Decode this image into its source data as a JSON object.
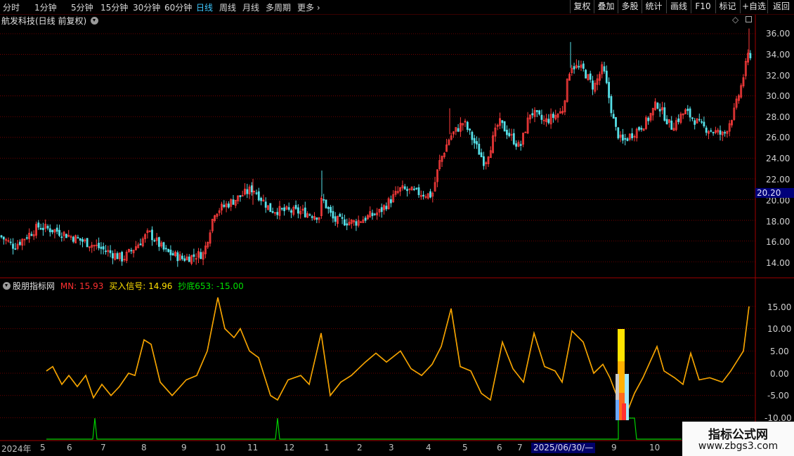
{
  "toolbar": {
    "timeframes": [
      "分时",
      "1分钟",
      "5分钟",
      "15分钟",
      "30分钟",
      "60分钟",
      "日线",
      "周线",
      "月线",
      "多周期",
      "更多"
    ],
    "active_timeframe": "日线",
    "right_buttons": [
      "复权",
      "叠加",
      "多股",
      "统计",
      "画线",
      "F10",
      "标记",
      "+自选",
      "返回"
    ]
  },
  "main_chart": {
    "title": "航发科技(日线 前复权)",
    "y_ticks": [
      "36.00",
      "34.00",
      "32.00",
      "30.00",
      "28.00",
      "26.00",
      "24.00",
      "22.00",
      "20.00",
      "18.00",
      "16.00",
      "14.00"
    ],
    "price_tag": "20.20"
  },
  "indicator": {
    "name": "股朋指标网",
    "mn_label": "MN: 15.93",
    "buy_label": "买入信号: 14.96",
    "bottom_label": "抄底653: -15.00",
    "y_ticks": [
      "15.00",
      "10.00",
      "5.00",
      "0.00",
      "-5.00",
      "-10.00"
    ]
  },
  "x_axis": {
    "labels": [
      "2024年",
      "5",
      "6",
      "7",
      "8",
      "9",
      "10",
      "11",
      "12",
      "1",
      "2",
      "3",
      "4",
      "5",
      "6",
      "7",
      "9",
      "10"
    ],
    "cursor_date": "2025/06/30/—"
  },
  "watermark": {
    "line1": "指标公式网",
    "line2": "www.zbgs3.com"
  },
  "colors": {
    "up": "#ff3c3c",
    "down": "#56e0e8",
    "mn_line": "#ff8c00",
    "buy_line": "#ffe000",
    "bottom_line": "#00d000",
    "grid": "#8a0000"
  }
}
